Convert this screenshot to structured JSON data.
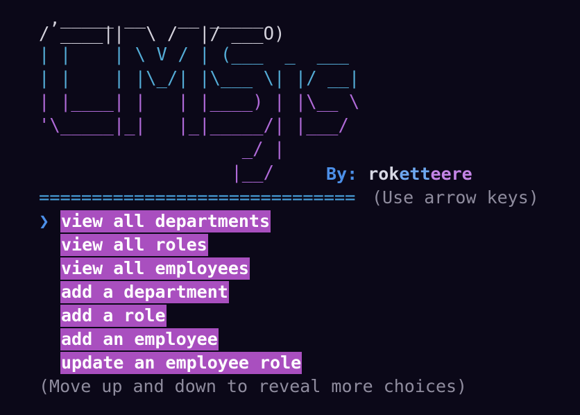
{
  "banner": {
    "lines": [
      {
        "text": " ,_____ __   __ _____ ",
        "color": "#d4d2dc"
      },
      {
        "text": "/ ____||  \\ /  |/ ___O)",
        "color": "#d4d2dc"
      },
      {
        "text": "| |    | \\ V / | (___  _  ___ ",
        "color": "#54acd6"
      },
      {
        "text": "| |    | |\\_/| |\\___ \\| |/ __|",
        "color": "#54acd6"
      },
      {
        "text": "| |____| |   | |____) | |\\__ \\",
        "color": "#b06ad8"
      },
      {
        "text": "'\\_____|_|   |_|_____/| |___/",
        "color": "#b06ad8"
      },
      {
        "text": "                   _/ |",
        "color": "#b06ad8"
      },
      {
        "text": "                  |__/",
        "color": "#b06ad8"
      }
    ]
  },
  "byline": {
    "label": "By:",
    "name_parts": [
      "rok",
      "ett",
      "eere"
    ]
  },
  "divider": "==============================",
  "hint": "(Use arrow keys)",
  "pointer": "❯",
  "choices": [
    "view all departments",
    "view all roles",
    "view all employees",
    "add a department",
    "add a role",
    "add an employee",
    "update an employee role"
  ],
  "selected_index": 0,
  "footer": "(Move up and down to reveal more choices)",
  "colors": {
    "background": "#0b0818",
    "highlight": "#a94fbf",
    "accent_blue": "#4c8fe8",
    "muted": "#8f8c9e"
  }
}
